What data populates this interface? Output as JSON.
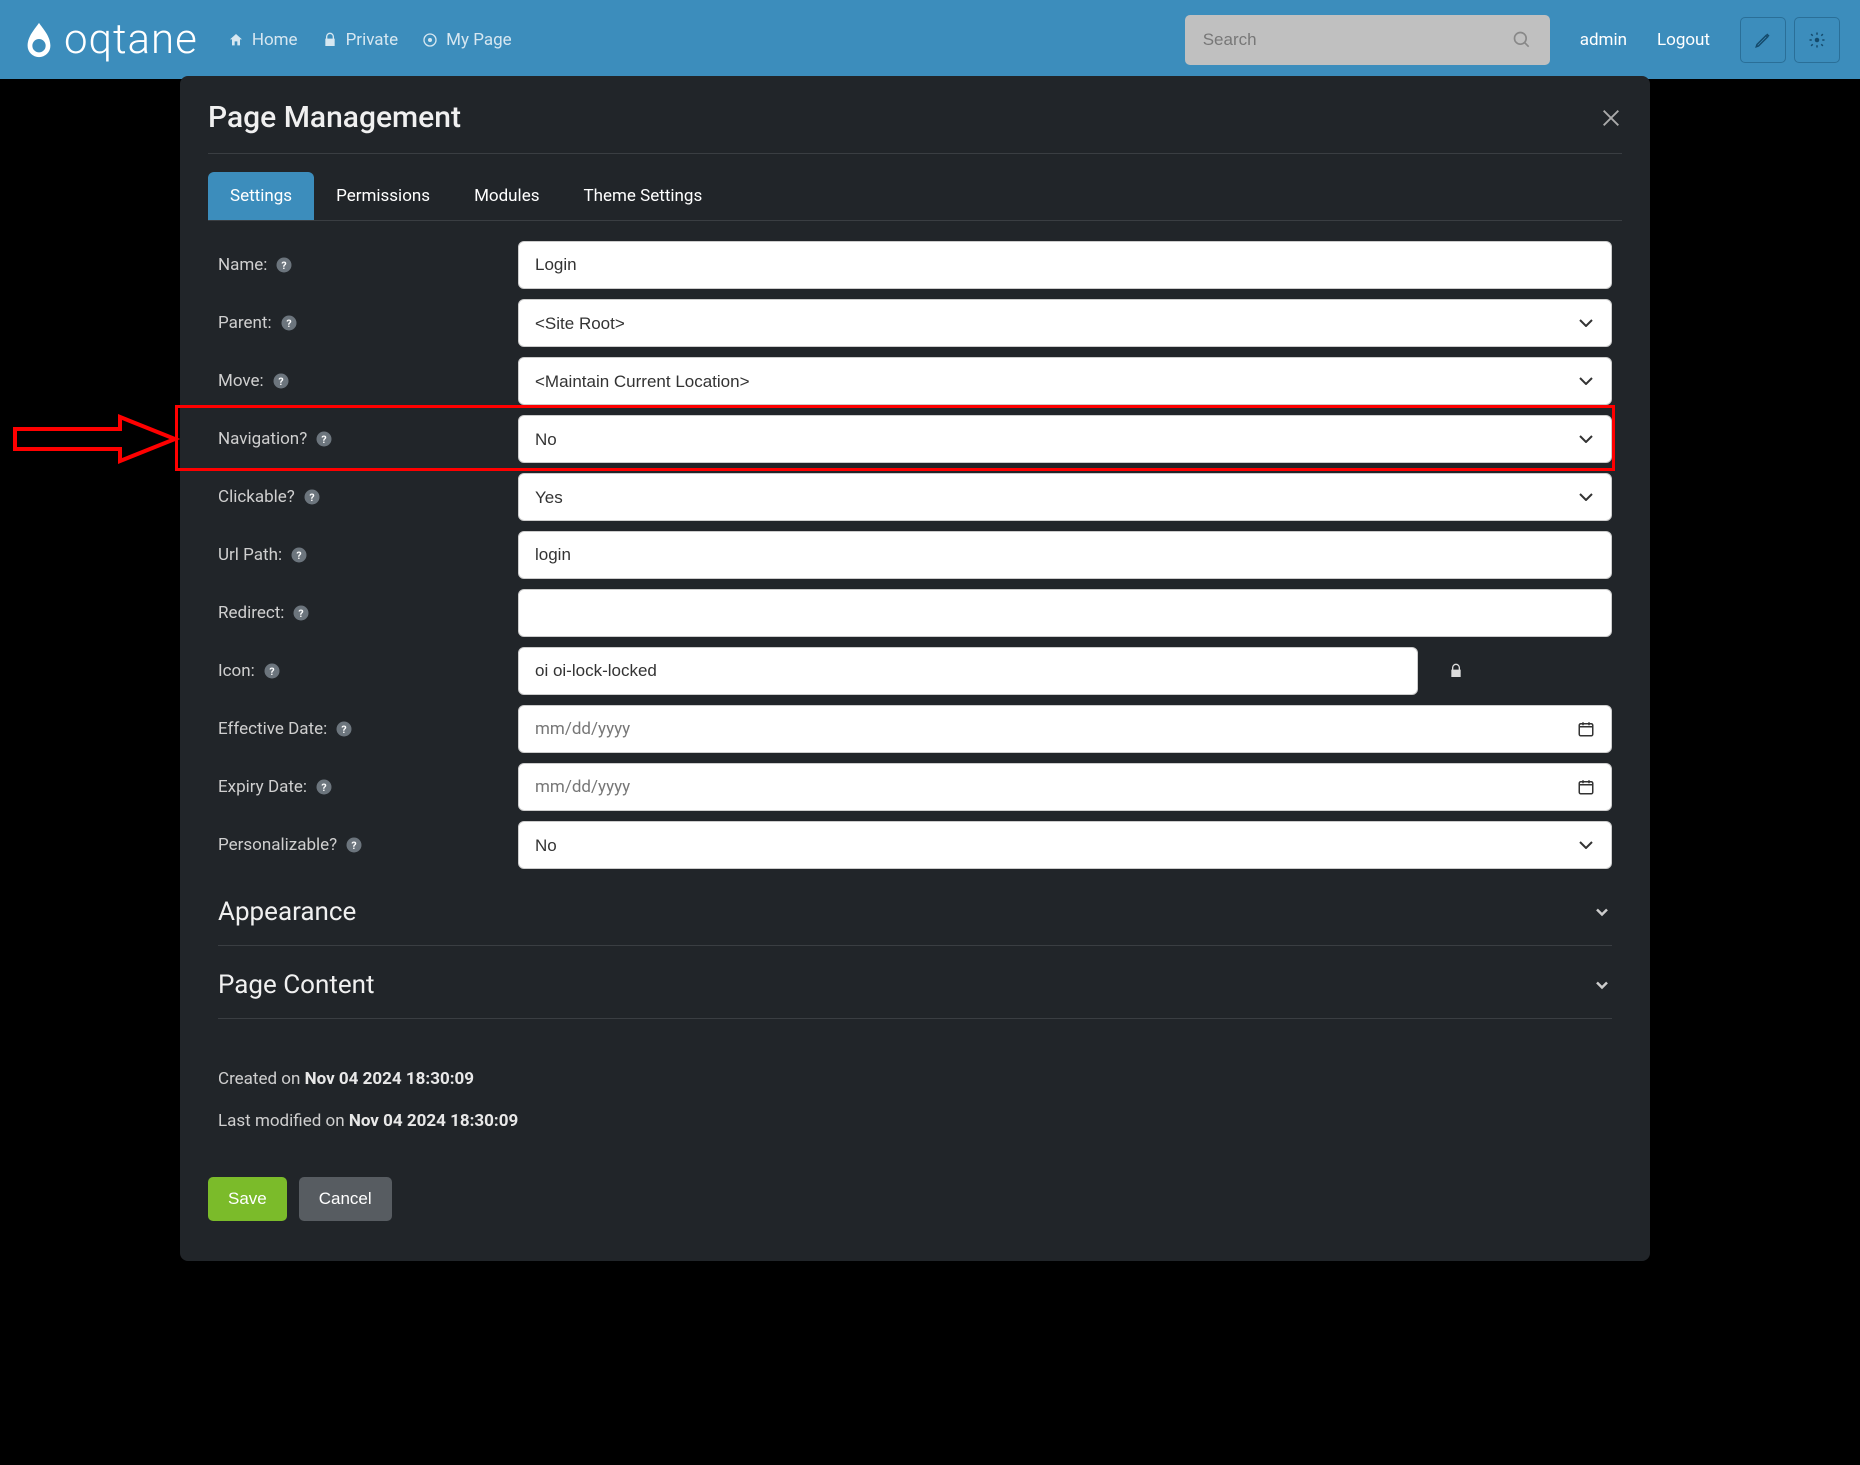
{
  "navbar": {
    "logo_text": "oqtane",
    "links": [
      {
        "icon": "home",
        "label": "Home"
      },
      {
        "icon": "lock",
        "label": "Private"
      },
      {
        "icon": "target",
        "label": "My Page"
      }
    ],
    "search_placeholder": "Search",
    "user": "admin",
    "logout": "Logout"
  },
  "modal": {
    "title": "Page Management",
    "tabs": [
      "Settings",
      "Permissions",
      "Modules",
      "Theme Settings"
    ],
    "active_tab": 0,
    "fields": {
      "name": {
        "label": "Name:",
        "value": "Login"
      },
      "parent": {
        "label": "Parent:",
        "value": "<Site Root>"
      },
      "move": {
        "label": "Move:",
        "value": "<Maintain Current Location>"
      },
      "navigation": {
        "label": "Navigation?",
        "value": "No"
      },
      "clickable": {
        "label": "Clickable?",
        "value": "Yes"
      },
      "url_path": {
        "label": "Url Path:",
        "value": "login"
      },
      "redirect": {
        "label": "Redirect:",
        "value": ""
      },
      "icon": {
        "label": "Icon:",
        "value": "oi oi-lock-locked"
      },
      "effective": {
        "label": "Effective Date:",
        "placeholder": "mm/dd/yyyy"
      },
      "expiry": {
        "label": "Expiry Date:",
        "placeholder": "mm/dd/yyyy"
      },
      "personalizable": {
        "label": "Personalizable?",
        "value": "No"
      }
    },
    "sections": {
      "appearance": "Appearance",
      "page_content": "Page Content"
    },
    "meta": {
      "created_label": "Created on ",
      "created_value": "Nov 04 2024 18:30:09",
      "modified_label": "Last modified on ",
      "modified_value": "Nov 04 2024 18:30:09"
    },
    "buttons": {
      "save": "Save",
      "cancel": "Cancel"
    }
  },
  "annotation": {
    "highlight_field": "move"
  }
}
